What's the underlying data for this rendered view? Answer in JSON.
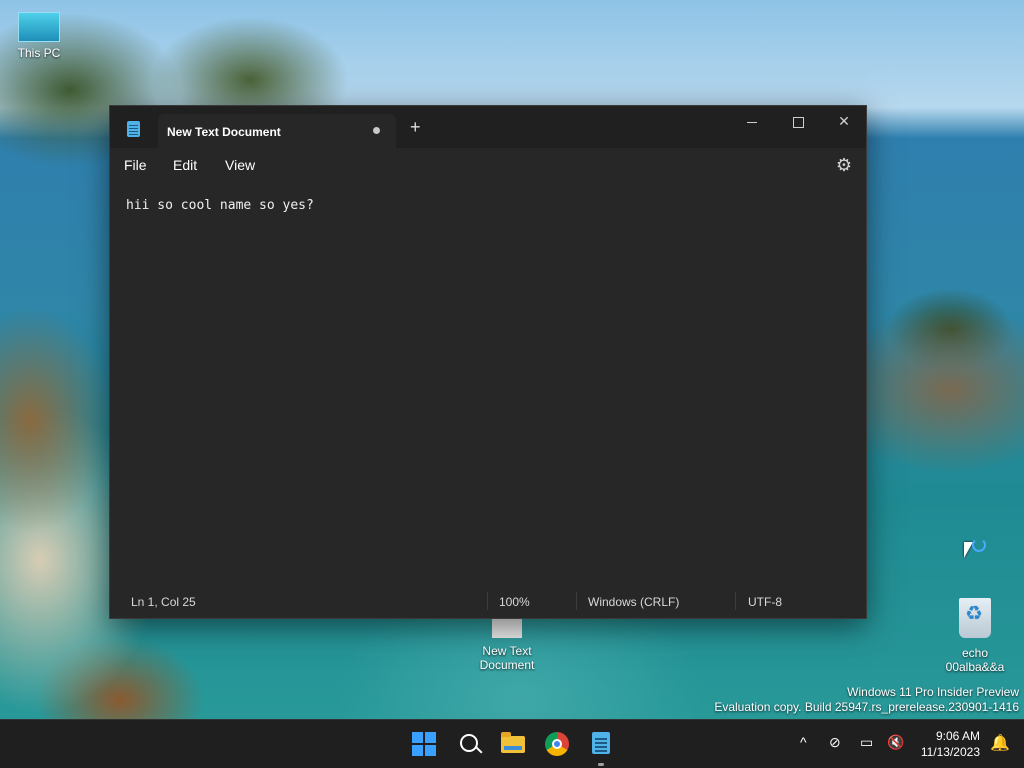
{
  "desktop": {
    "icons": [
      {
        "label": "This PC"
      },
      {
        "label": "New Text Document"
      },
      {
        "label": "echo 00alba&&a"
      }
    ],
    "watermark": {
      "line1": "Windows 11 Pro Insider Preview",
      "line2": "Evaluation copy. Build 25947.rs_prerelease.230901-1416"
    }
  },
  "notepad": {
    "tab_title": "New Text Document",
    "new_tab": "+",
    "window_controls": {
      "minimize": "minimize-icon",
      "maximize": "maximize-icon",
      "close": "✕"
    },
    "menu": {
      "file": "File",
      "edit": "Edit",
      "view": "View",
      "settings_icon": "⚙"
    },
    "content": "hii so cool name so yes?",
    "status": {
      "position": "Ln 1, Col 25",
      "zoom": "100%",
      "line_ending": "Windows (CRLF)",
      "encoding": "UTF-8"
    }
  },
  "taskbar": {
    "apps": [
      "start-icon",
      "search-icon",
      "file-explorer-icon",
      "chrome-icon",
      "notepad-icon"
    ],
    "tray": {
      "chevron": "^",
      "network": "⊘",
      "display": "▭",
      "volume": "🔇"
    },
    "clock": {
      "time": "9:06 AM",
      "date": "11/13/2023"
    },
    "notifications": "🔔",
    "accent": "#3aa0ff"
  }
}
